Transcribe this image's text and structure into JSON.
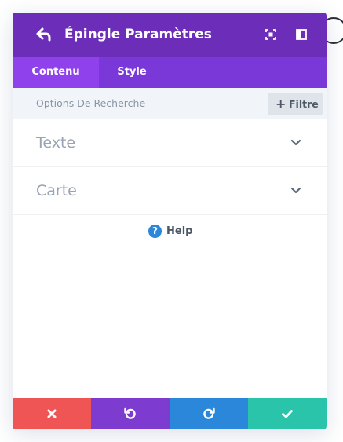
{
  "header": {
    "title": "Épingle Paramètres",
    "bg_color": "#6c2eb9"
  },
  "tabs": [
    {
      "label": "Contenu",
      "active": true
    },
    {
      "label": "Style",
      "active": false
    }
  ],
  "search": {
    "placeholder": "Options De Recherche",
    "filter_label": "Filtre"
  },
  "sections": [
    {
      "title": "Texte"
    },
    {
      "title": "Carte"
    }
  ],
  "help": {
    "label": "Help"
  },
  "footer": {
    "colors": {
      "cancel": "#ef5555",
      "undo": "#7e3bd0",
      "redo": "#2b87da",
      "save": "#29c4a9"
    }
  }
}
